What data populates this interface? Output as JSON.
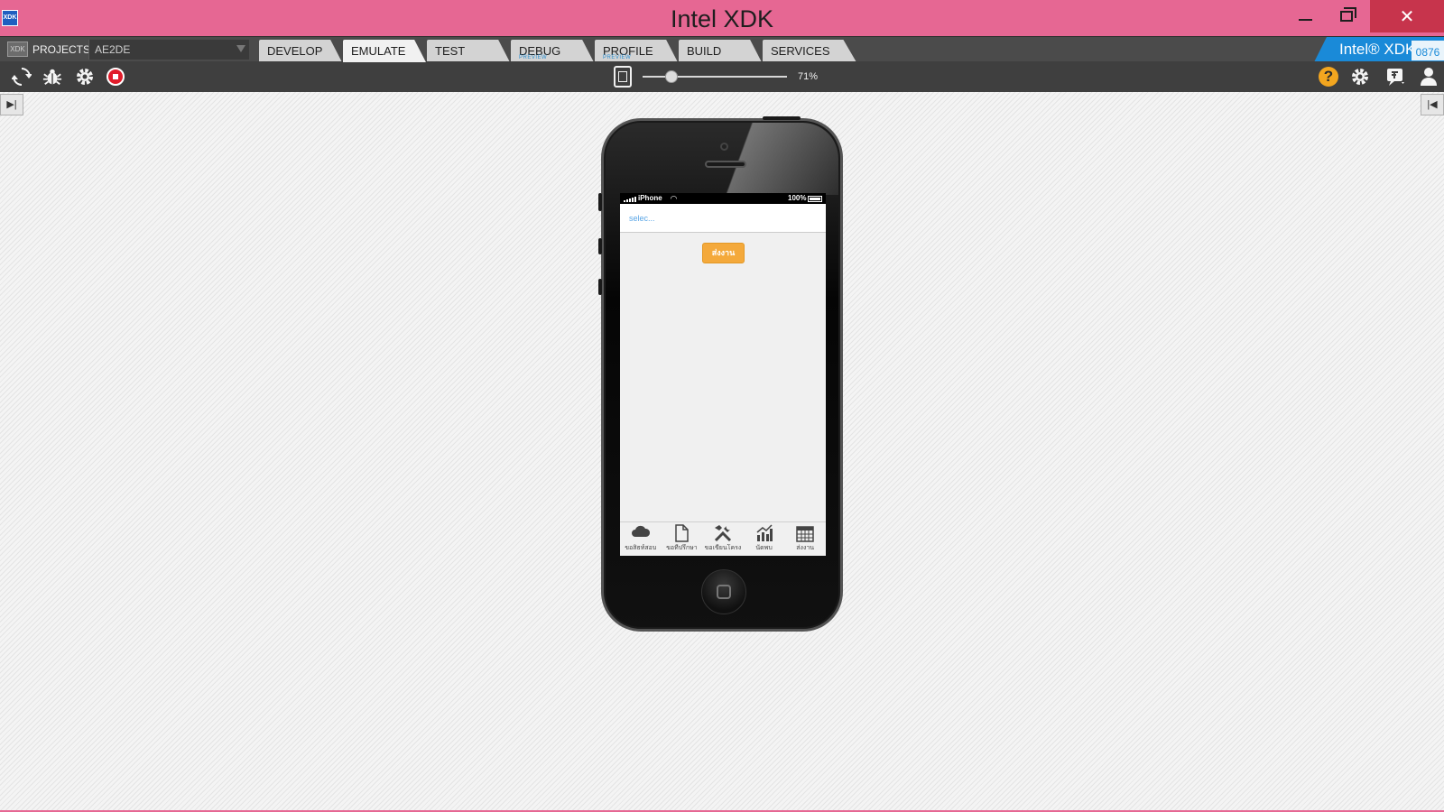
{
  "window": {
    "title": "Intel XDK",
    "app_icon_text": "XDK",
    "close_glyph": "✕"
  },
  "tabbar": {
    "projects_icon_text": "XDK",
    "projects_label": "PROJECTS",
    "project_name": "AE2DE",
    "tabs": [
      {
        "label": "DEVELOP",
        "sub": ""
      },
      {
        "label": "EMULATE",
        "sub": ""
      },
      {
        "label": "TEST",
        "sub": ""
      },
      {
        "label": "DEBUG",
        "sub": "PREVIEW"
      },
      {
        "label": "PROFILE",
        "sub": "PREVIEW"
      },
      {
        "label": "BUILD",
        "sub": ""
      },
      {
        "label": "SERVICES",
        "sub": ""
      }
    ],
    "active_tab": "EMULATE",
    "brand": "Intel® XDK",
    "brand_code": "0876"
  },
  "toolbar": {
    "zoom": "71%",
    "zoom_value": 0.2,
    "icons": {
      "reload": "reload-icon",
      "debug": "bug-icon",
      "settings": "gear-icon",
      "stop": "stop-icon",
      "fit": "fit-screen-icon",
      "help": "help-icon",
      "user": "user-icon"
    },
    "help_glyph": "?"
  },
  "device": {
    "carrier": "iPhone",
    "battery": "100%",
    "select_placeholder": "selec...",
    "submit_label": "ส่งงาน",
    "nav": [
      {
        "label": "ขอสิธท์สอบ",
        "icon": "cloud-icon"
      },
      {
        "label": "ขอที่ปรึกษา",
        "icon": "document-icon"
      },
      {
        "label": "ขอเขียนโครง",
        "icon": "tools-icon"
      },
      {
        "label": "นัดพบ",
        "icon": "chart-icon"
      },
      {
        "label": "ส่งงาน",
        "icon": "calendar-icon"
      }
    ]
  },
  "colors": {
    "titlebar": "#e66793",
    "close": "#c7344c",
    "brand": "#1a8ad8",
    "accent_button": "#f4a93b",
    "stop": "#e01c2a",
    "help": "#f3a61f"
  }
}
